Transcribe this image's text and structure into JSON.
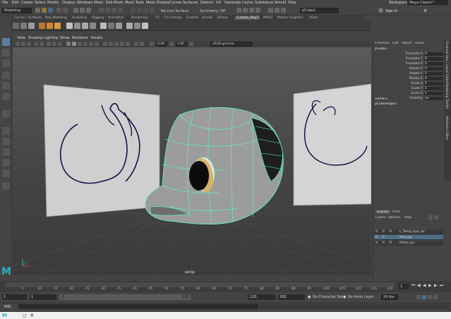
{
  "menubar": {
    "items": [
      "File",
      "Edit",
      "Create",
      "Select",
      "Modify",
      "Display",
      "Windows",
      "Mesh",
      "Edit Mesh",
      "Mesh Tools",
      "Mesh Display",
      "Curves",
      "Surfaces",
      "Deform",
      "UV",
      "Generate",
      "Cache",
      "Substance",
      "Arnold",
      "Help"
    ],
    "workspace_label": "Workspace :",
    "workspace_value": "Maya Classic*"
  },
  "statusline": {
    "mode_value": "Modeling",
    "live_surface": "No Live Surface",
    "symmetry": "Symmetry: Off",
    "object_field": "pCube1",
    "signin": "Sign In"
  },
  "shelf": {
    "tabs": [
      "Curves / Surfaces",
      "Poly Modeling",
      "Sculpting",
      "Rigging",
      "Animation",
      "Rendering",
      "FX",
      "FX Caching",
      "Custom",
      "Arnold",
      "Bifrost",
      "Custom_PolyT",
      "MASH",
      "Motion Graphics",
      "XGen"
    ],
    "active_tab_index": 11,
    "icon_colors": [
      "#6a6a6a",
      "#7b7b7b",
      "#9a9a9a",
      "#b97a2e",
      "#c9852f",
      "#d99a3c",
      "#c2c2c2",
      "#909090",
      "#aaaaaa",
      "#888888",
      "#bbbbbb",
      "#777777",
      "#9a9a9a",
      "#aaaaaa",
      "#8a8a8a",
      "#bfbfbf"
    ]
  },
  "viewport": {
    "menu": [
      "View",
      "Shading",
      "Lighting",
      "Show",
      "Renderer",
      "Panels"
    ],
    "field_near": "0.00",
    "field_far": "1.00",
    "colorspace": "sRGB gamma",
    "camera_label": "persp"
  },
  "channelbox": {
    "tabs": [
      "Channels",
      "Edit",
      "Object",
      "Show"
    ],
    "object_name": "pCube1",
    "attributes": [
      {
        "label": "Translate X",
        "value": "0"
      },
      {
        "label": "Translate Y",
        "value": "0"
      },
      {
        "label": "Translate Z",
        "value": "0"
      },
      {
        "label": "Rotate X",
        "value": "0"
      },
      {
        "label": "Rotate Y",
        "value": "0"
      },
      {
        "label": "Rotate Z",
        "value": "0"
      },
      {
        "label": "Scale X",
        "value": "1"
      },
      {
        "label": "Scale Y",
        "value": "1"
      },
      {
        "label": "Scale Z",
        "value": "1"
      },
      {
        "label": "Visibility",
        "value": "on"
      }
    ],
    "shapes_header": "SHAPES",
    "shape_name": "pCubeShape1"
  },
  "sidetabs": [
    "Channel Box / Layer Editor",
    "Modeling Toolkit",
    "Attribute Editor"
  ],
  "layers": {
    "tabs": [
      "Display",
      "Anim"
    ],
    "menu": [
      "Layers",
      "Options",
      "Help"
    ],
    "rows": [
      {
        "v": "V",
        "p": "P",
        "r": "R",
        "name": "L_Temp_Eye_Lyr",
        "active": false
      },
      {
        "v": "V",
        "p": "P",
        "r": "",
        "name": "Geo_Lyr",
        "active": true
      },
      {
        "v": "V",
        "p": "P",
        "r": "R",
        "name": "Ortho_Lyr",
        "active": false
      }
    ]
  },
  "timeline": {
    "ticks": [
      "5",
      "10",
      "15",
      "20",
      "25",
      "30",
      "35",
      "40",
      "45",
      "50",
      "55",
      "60",
      "65",
      "70",
      "75",
      "80",
      "85",
      "90",
      "95",
      "100",
      "105",
      "110",
      "115",
      "120"
    ],
    "current_frame": "1"
  },
  "range": {
    "start": "1",
    "inner_start": "1",
    "inner_end": "120",
    "end": "120",
    "max_end": "200",
    "character_set": "No Character Set",
    "anim_layer": "No Anim Layer",
    "fps": "24 fps"
  },
  "mel": {
    "label": "MEL"
  },
  "colors": {
    "accent_wire": "#5ff0b4",
    "sketch_line": "#14144a",
    "layer_active": "#4d6f86"
  }
}
